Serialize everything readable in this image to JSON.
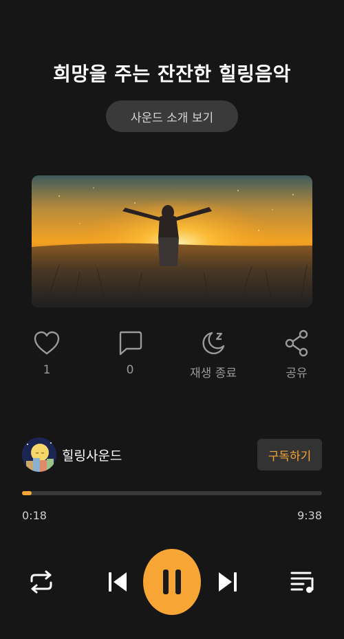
{
  "header": {
    "title": "희망을 주는 잔잔한 힐링음악",
    "intro_button": "사운드 소개 보기"
  },
  "artwork": {
    "description_icon": "sunset-field-image"
  },
  "actions": [
    {
      "icon": "heart-icon",
      "label": "1"
    },
    {
      "icon": "comment-icon",
      "label": "0"
    },
    {
      "icon": "sleep-timer-icon",
      "label": "재생 종료"
    },
    {
      "icon": "share-icon",
      "label": "공유"
    }
  ],
  "channel": {
    "name": "힐링사운드",
    "subscribe_label": "구독하기"
  },
  "player": {
    "current_time": "0:18",
    "total_time": "9:38",
    "progress": 0.032,
    "state": "playing"
  },
  "colors": {
    "background": "#161616",
    "accent": "#f7a535",
    "muted_text": "#9a9a9a"
  }
}
